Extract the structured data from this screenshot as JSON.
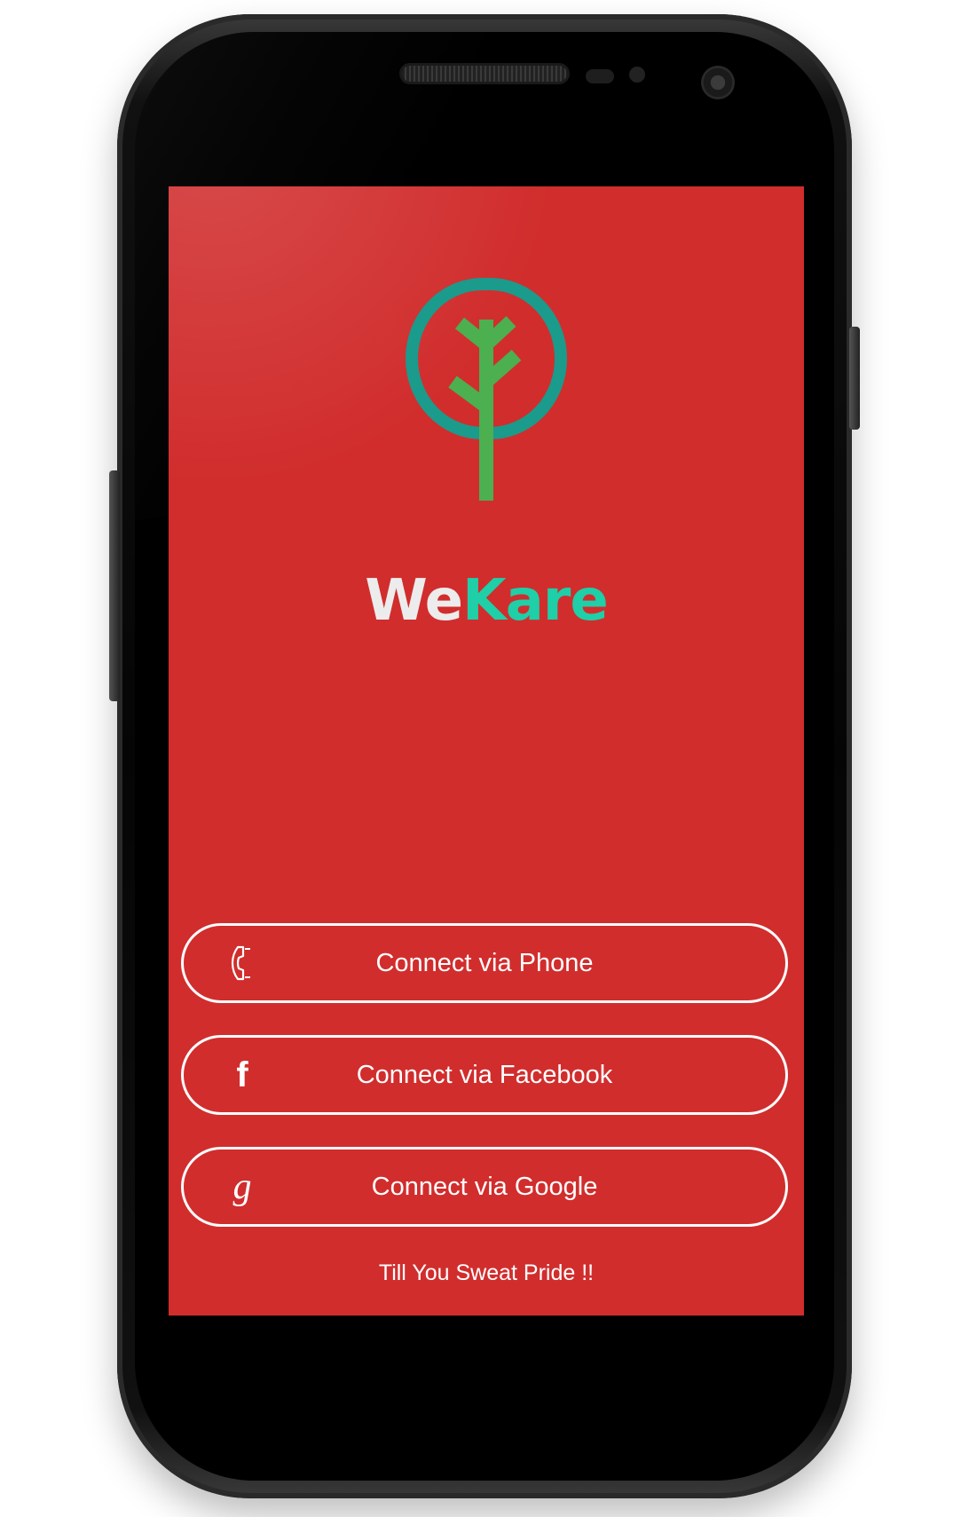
{
  "app": {
    "brand_first": "We",
    "brand_second": "Kare",
    "logo_icon": "tree-in-circle-icon"
  },
  "buttons": {
    "phone": {
      "label": "Connect via Phone",
      "icon": "phone-icon"
    },
    "facebook": {
      "label": "Connect via Facebook",
      "icon": "facebook-icon",
      "glyph": "f"
    },
    "google": {
      "label": "Connect via Google",
      "icon": "google-icon",
      "glyph": "g"
    }
  },
  "tagline": "Till You Sweat Pride !!",
  "colors": {
    "screen_background": "#d12d2d",
    "brand_we": "#ececec",
    "brand_kare": "#1ecfa8",
    "logo_ring": "#1a9b8c",
    "logo_tree": "#4caf50",
    "button_border": "#ffffff"
  }
}
